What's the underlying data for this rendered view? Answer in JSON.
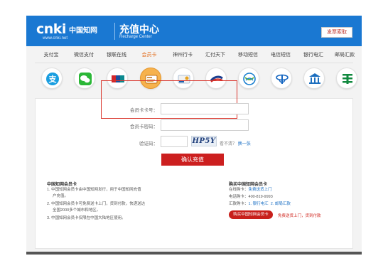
{
  "header": {
    "logo_text": "cnki",
    "logo_cn": "中国知网",
    "logo_url": "www.cnki.net",
    "title_cn": "充值中心",
    "title_en": "Recharge Center",
    "feedback_label": "发票索取"
  },
  "tabs": [
    {
      "label": "支付宝"
    },
    {
      "label": "微信支付"
    },
    {
      "label": "银联在线"
    },
    {
      "label": "会员卡"
    },
    {
      "label": "神州行卡"
    },
    {
      "label": "汇付天下"
    },
    {
      "label": "移动短信"
    },
    {
      "label": "电信短信"
    },
    {
      "label": "银行电汇"
    },
    {
      "label": "邮局汇款"
    }
  ],
  "active_tab": "会员卡",
  "icons": [
    "alipay-icon",
    "wechat-icon",
    "unionpay-icon",
    "member-card-icon",
    "shenzhouxing-icon",
    "chinapnr-icon",
    "china-mobile-icon",
    "china-telecom-icon",
    "bank-icon",
    "post-office-icon"
  ],
  "form": {
    "card_number_label": "会员卡卡号：",
    "card_password_label": "会员卡密码：",
    "captcha_label": "验证码：",
    "captcha_text": "HP5Y",
    "captcha_hint": "看不清？",
    "captcha_refresh": "换一张",
    "confirm_label": "确认充值"
  },
  "info_left": {
    "heading": "中国知网会员卡",
    "line1": "1. 中国知网会员卡由中国知网发行，用于中国知网充值",
    "line1b": "户充值。",
    "line2": "2. 中国知网会员卡可免费送卡上门，货到付款，快递送达",
    "line2b": "全国2000多个城市和地区。",
    "line3": "3. 中国知网会员卡仅限在中国大陆地区使用。"
  },
  "info_right": {
    "heading": "购买中国知网会员卡",
    "online_label": "在线购卡：",
    "online_value": "免费送货上门",
    "phone_label": "电话购卡：",
    "phone_value": "400-819-9993",
    "remit_label": "汇款购卡：",
    "remit_value1": "1. 银行电汇",
    "remit_value2": "2. 邮局汇款",
    "buy_button": "购买中国知网会员卡",
    "buy_note": "免费送货上门，货到付款"
  },
  "colors": {
    "header_bg": "#1a78d2",
    "active_tab": "#e26b1a",
    "frame_red": "#d9342b",
    "button_red": "#cc1f1f"
  }
}
